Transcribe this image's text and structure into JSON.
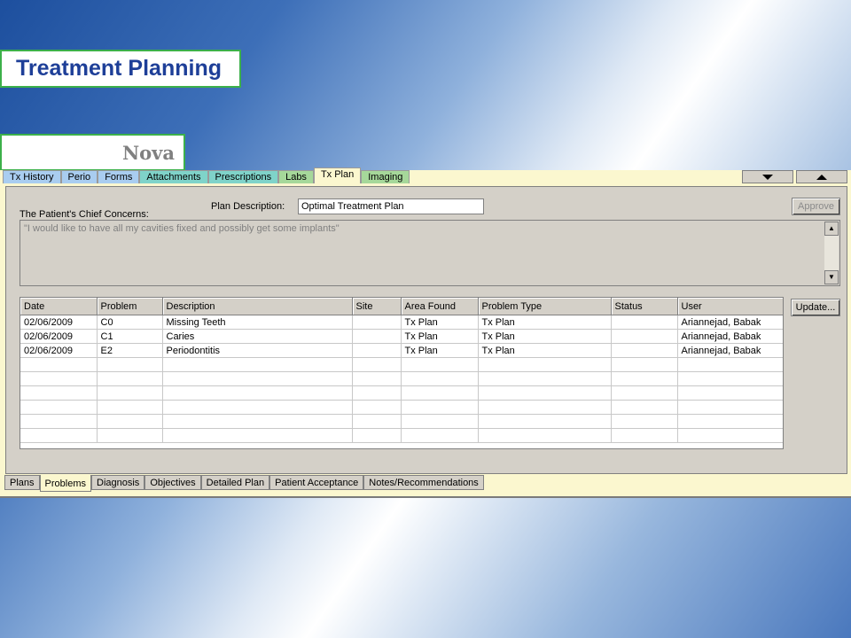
{
  "slide": {
    "title": "Treatment Planning",
    "brand": "Nova"
  },
  "top_tabs": [
    {
      "label": "Tx History",
      "color": "#a9cdf0"
    },
    {
      "label": "Perio",
      "color": "#a9cdf0"
    },
    {
      "label": "Forms",
      "color": "#a9cdf0"
    },
    {
      "label": "Attachments",
      "color": "#7fd3c9"
    },
    {
      "label": "Prescriptions",
      "color": "#7fd3c9"
    },
    {
      "label": "Labs",
      "color": "#a6d89a"
    },
    {
      "label": "Tx Plan",
      "color": "#fbf7cf"
    },
    {
      "label": "Imaging",
      "color": "#a6d89a"
    }
  ],
  "window_controls": {
    "down_icon": "triangle-down-icon",
    "up_icon": "triangle-up-icon"
  },
  "plan": {
    "chief_concerns_label": "The Patient's Chief Concerns:",
    "description_label": "Plan Description:",
    "description_value": "Optimal Treatment Plan",
    "approve_label": "Approve",
    "concerns_text": "\"I would like to have all my cavities fixed and possibly get some implants\""
  },
  "problems_table": {
    "headers": [
      "Date",
      "Problem",
      "Description",
      "Site",
      "Area Found",
      "Problem Type",
      "Status",
      "User"
    ],
    "rows": [
      [
        "02/06/2009",
        "C0",
        "Missing Teeth",
        "",
        "Tx Plan",
        "Tx Plan",
        "",
        "Ariannejad, Babak"
      ],
      [
        "02/06/2009",
        "C1",
        "Caries",
        "",
        "Tx Plan",
        "Tx Plan",
        "",
        "Ariannejad, Babak"
      ],
      [
        "02/06/2009",
        "E2",
        "Periodontitis",
        "",
        "Tx Plan",
        "Tx Plan",
        "",
        "Ariannejad, Babak"
      ]
    ],
    "update_label": "Update..."
  },
  "bottom_tabs": [
    "Plans",
    "Problems",
    "Diagnosis",
    "Objectives",
    "Detailed Plan",
    "Patient Acceptance",
    "Notes/Recommendations"
  ],
  "active_bottom_tab": "Problems"
}
